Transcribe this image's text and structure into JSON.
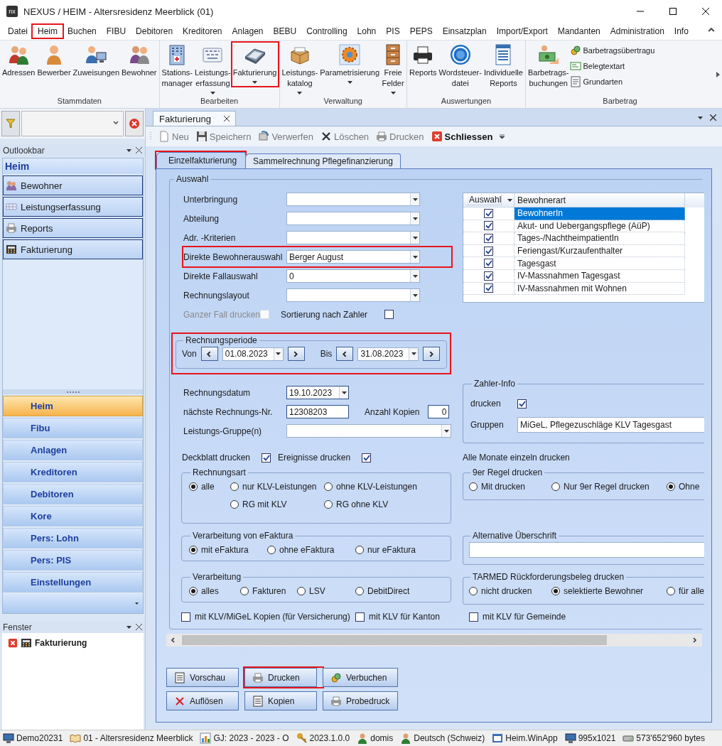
{
  "window": {
    "logo": "nx",
    "title": "NEXUS / HEIM - Altersresidenz Meerblick (01)"
  },
  "menu": [
    {
      "label": "Datei",
      "highlighted": false
    },
    {
      "label": "Heim",
      "highlighted": true
    },
    {
      "label": "Buchen",
      "highlighted": false
    },
    {
      "label": "FIBU",
      "highlighted": false
    },
    {
      "label": "Debitoren",
      "highlighted": false
    },
    {
      "label": "Kreditoren",
      "highlighted": false
    },
    {
      "label": "Anlagen",
      "highlighted": false
    },
    {
      "label": "BEBU",
      "highlighted": false
    },
    {
      "label": "Controlling",
      "highlighted": false
    },
    {
      "label": "Lohn",
      "highlighted": false
    },
    {
      "label": "PIS",
      "highlighted": false
    },
    {
      "label": "PEPS",
      "highlighted": false
    },
    {
      "label": "Einsatzplan",
      "highlighted": false
    },
    {
      "label": "Import/Export",
      "highlighted": false
    },
    {
      "label": "Mandanten",
      "highlighted": false
    },
    {
      "label": "Administration",
      "highlighted": false
    },
    {
      "label": "Info",
      "highlighted": false
    }
  ],
  "ribbon": {
    "groups": [
      {
        "label": "Stammdaten",
        "buttons": [
          {
            "kind": "large",
            "label": "Adressen",
            "dropdown": false,
            "highlighted": false
          },
          {
            "kind": "large",
            "label": "Bewerber",
            "dropdown": false,
            "highlighted": false
          },
          {
            "kind": "large",
            "label": "Zuweisungen",
            "dropdown": false,
            "highlighted": false
          },
          {
            "kind": "large",
            "label": "Bewohner",
            "dropdown": false,
            "highlighted": false
          }
        ]
      },
      {
        "label": "Bearbeiten",
        "buttons": [
          {
            "kind": "large",
            "label": "Stations-\nmanager",
            "dropdown": false,
            "highlighted": false
          },
          {
            "kind": "large",
            "label": "Leistungs-\nerfassung",
            "dropdown": true,
            "highlighted": false
          },
          {
            "kind": "large",
            "label": "Fakturierung",
            "dropdown": true,
            "highlighted": true
          }
        ]
      },
      {
        "label": "Verwaltung",
        "buttons": [
          {
            "kind": "large",
            "label": "Leistungs-\nkatalog",
            "dropdown": true,
            "highlighted": false
          },
          {
            "kind": "large",
            "label": "Parametrisierung",
            "dropdown": true,
            "highlighted": false
          },
          {
            "kind": "large",
            "label": "Freie\nFelder",
            "dropdown": true,
            "highlighted": false
          }
        ]
      },
      {
        "label": "Auswertungen",
        "buttons": [
          {
            "kind": "large",
            "label": "Reports",
            "dropdown": false,
            "highlighted": false
          },
          {
            "kind": "large",
            "label": "Wordsteuer-\ndatei",
            "dropdown": false,
            "highlighted": false
          },
          {
            "kind": "large",
            "label": "Individuelle\nReports",
            "dropdown": false,
            "highlighted": false
          }
        ]
      },
      {
        "label": "Barbetrag",
        "buttons": [
          {
            "kind": "large",
            "label": "Barbetrags-\nbuchungen",
            "dropdown": false,
            "highlighted": false
          },
          {
            "kind": "small",
            "label": "Barbetragsübertragu",
            "dropdown": false,
            "highlighted": false
          },
          {
            "kind": "small",
            "label": "Belegtextart",
            "dropdown": false,
            "highlighted": false
          },
          {
            "kind": "small",
            "label": "Grundarten",
            "dropdown": false,
            "highlighted": false
          }
        ]
      }
    ]
  },
  "sidebar": {
    "outlookbar": {
      "title": "Outlookbar",
      "section": "Heim",
      "items": [
        "Bewohner",
        "Leistungserfassung",
        "Reports",
        "Fakturierung"
      ]
    },
    "nav": [
      {
        "label": "Heim",
        "selected": true
      },
      {
        "label": "Fibu",
        "selected": false
      },
      {
        "label": "Anlagen",
        "selected": false
      },
      {
        "label": "Kreditoren",
        "selected": false
      },
      {
        "label": "Debitoren",
        "selected": false
      },
      {
        "label": "Kore",
        "selected": false
      },
      {
        "label": "Pers: Lohn",
        "selected": false
      },
      {
        "label": "Pers: PIS",
        "selected": false
      },
      {
        "label": "Einstellungen",
        "selected": false
      }
    ],
    "fenster": {
      "title": "Fenster",
      "items": [
        "Fakturierung"
      ]
    }
  },
  "document": {
    "tab": "Fakturierung",
    "toolbar": [
      {
        "label": "Neu",
        "disabled": true
      },
      {
        "label": "Speichern",
        "disabled": true
      },
      {
        "label": "Verwerfen",
        "disabled": true
      },
      {
        "label": "Löschen",
        "disabled": true
      },
      {
        "label": "Drucken",
        "disabled": true
      },
      {
        "label": "Schliessen",
        "disabled": false
      }
    ],
    "tabs": [
      {
        "label": "Einzelfakturierung",
        "selected": true,
        "highlighted": true
      },
      {
        "label": "Sammelrechnung Pflegefinanzierung",
        "selected": false,
        "highlighted": false
      }
    ],
    "auswahl": {
      "title": "Auswahl",
      "fields": [
        {
          "label": "Unterbringung",
          "highlighted": false
        },
        {
          "label": "Abteilung",
          "highlighted": false
        },
        {
          "label": "Adr. -Kriterien",
          "highlighted": false
        },
        {
          "label": "Direkte Bewohnerauswahl",
          "value": "Berger August",
          "highlighted": true
        },
        {
          "label": "Direkte Fallauswahl",
          "value": "0",
          "highlighted": false
        },
        {
          "label": "Rechnungslayout",
          "highlighted": false
        }
      ],
      "ganzer_fall": {
        "label": "Ganzer Fall drucken",
        "checked": false,
        "disabled": true
      },
      "sortierung": {
        "label": "Sortierung nach Zahler",
        "checked": false
      },
      "bewohnerart": {
        "columns": [
          "Auswahl",
          "Bewohnerart"
        ],
        "rows": [
          {
            "checked": true,
            "label": "BewohnerIn",
            "selected": true
          },
          {
            "checked": true,
            "label": "Akut- und Uebergangspflege (AüP)",
            "selected": false
          },
          {
            "checked": true,
            "label": "Tages-/NachtheimpatientIn",
            "selected": false
          },
          {
            "checked": true,
            "label": "Feriengast/Kurzaufenthalter",
            "selected": false
          },
          {
            "checked": true,
            "label": "Tagesgast",
            "selected": false
          },
          {
            "checked": true,
            "label": "IV-Massnahmen Tagesgast",
            "selected": false
          },
          {
            "checked": true,
            "label": "IV-Massnahmen mit Wohnen",
            "selected": false
          }
        ]
      },
      "periode": {
        "title": "Rechnungsperiode",
        "highlighted": true,
        "von_label": "Von",
        "von": "01.08.2023",
        "bis_label": "Bis",
        "bis": "31.08.2023"
      },
      "rechnungsdatum": {
        "label": "Rechnungsdatum",
        "value": "19.10.2023"
      },
      "naechste_nr": {
        "label": "nächste Rechnungs-Nr.",
        "value": "12308203"
      },
      "anzahl_kopien": {
        "label": "Anzahl Kopien",
        "value": "0"
      },
      "leistungsgruppe": {
        "label": "Leistungs-Gruppe(n)"
      },
      "zahler_info": {
        "title": "Zahler-Info",
        "drucken": {
          "label": "drucken",
          "checked": true
        },
        "gruppen": {
          "label": "Gruppen",
          "value": "MiGeL, Pflegezuschläge KLV Tagesgast"
        }
      },
      "deckblatt": {
        "label": "Deckblatt drucken",
        "checked": true
      },
      "ereignisse": {
        "label": "Ereignisse drucken",
        "checked": true
      },
      "alle_monate": "Alle Monate einzeln drucken",
      "rechnungsart": {
        "title": "Rechnungsart",
        "options": [
          {
            "label": "alle",
            "selected": true
          },
          {
            "label": "nur KLV-Leistungen",
            "selected": false
          },
          {
            "label": "ohne KLV-Leistungen",
            "selected": false
          },
          {
            "label": "RG mit KLV",
            "selected": false
          },
          {
            "label": "RG ohne KLV",
            "selected": false
          }
        ]
      },
      "regel9": {
        "title": "9er Regel drucken",
        "options": [
          {
            "label": "Mit drucken",
            "selected": false
          },
          {
            "label": "Nur 9er Regel drucken",
            "selected": false
          },
          {
            "label": "Ohne",
            "selected": true
          }
        ]
      },
      "efaktura": {
        "title": "Verarbeitung von eFaktura",
        "options": [
          {
            "label": "mit eFaktura",
            "selected": true
          },
          {
            "label": "ohne eFaktura",
            "selected": false
          },
          {
            "label": "nur eFaktura",
            "selected": false
          }
        ]
      },
      "alt_ueberschrift": {
        "title": "Alternative Überschrift"
      },
      "verarbeitung": {
        "title": "Verarbeitung",
        "options": [
          {
            "label": "alles",
            "selected": true
          },
          {
            "label": "Fakturen",
            "selected": false
          },
          {
            "label": "LSV",
            "selected": false
          },
          {
            "label": "DebitDirect",
            "selected": false
          }
        ]
      },
      "tarmed": {
        "title": "TARMED Rückforderungsbeleg drucken",
        "options": [
          {
            "label": "nicht drucken",
            "selected": false
          },
          {
            "label": "selektierte Bewohner",
            "selected": true
          },
          {
            "label": "für alle",
            "selected": false
          }
        ]
      },
      "copies": [
        {
          "label": "mit KLV/MiGeL Kopien (für Versicherung)",
          "checked": false
        },
        {
          "label": "mit KLV für Kanton",
          "checked": false
        },
        {
          "label": "mit KLV für Gemeinde",
          "checked": false
        }
      ]
    },
    "buttons": [
      {
        "label": "Vorschau",
        "highlighted": false
      },
      {
        "label": "Drucken",
        "highlighted": true
      },
      {
        "label": "Verbuchen",
        "highlighted": false
      },
      {
        "label": "Auflösen",
        "highlighted": false
      },
      {
        "label": "Kopien",
        "highlighted": false
      },
      {
        "label": "Probedruck",
        "highlighted": false
      }
    ]
  },
  "status_bar": [
    "Demo20231",
    "01 - Altersresidenz Meerblick",
    "GJ: 2023 - 2023 - O",
    "2023.1.0.0",
    "domis",
    "Deutsch (Schweiz)",
    "Heim.WinApp",
    "995x1021",
    "573'652'960 bytes"
  ]
}
